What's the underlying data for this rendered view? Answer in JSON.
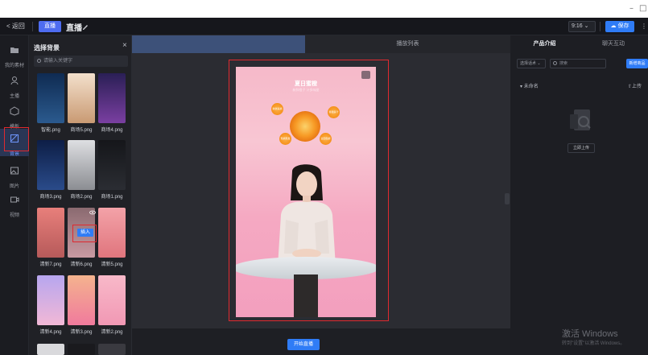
{
  "window": {
    "minimize": "–",
    "maximize": "□"
  },
  "topbar": {
    "back_label": "< 返回",
    "mode_label": "直播",
    "title": "直播",
    "ratio_label": "9:16",
    "save_label": "保存"
  },
  "rail": {
    "items": [
      {
        "label": "我的素材",
        "icon": "folder-icon"
      },
      {
        "label": "主播",
        "icon": "person-icon"
      },
      {
        "label": "模板",
        "icon": "cube-icon"
      },
      {
        "label": "背景",
        "icon": "background-icon",
        "active": true
      },
      {
        "label": "图片",
        "icon": "image-icon"
      },
      {
        "label": "视频",
        "icon": "video-icon"
      }
    ]
  },
  "picker": {
    "title": "选择背景",
    "search_placeholder": "请输入关键字",
    "insert_label": "插入",
    "thumbs": [
      {
        "name": "智能.png",
        "colors": [
          "#0f2b52",
          "#2b5a8e"
        ]
      },
      {
        "name": "商场5.png",
        "colors": [
          "#f3e0cc",
          "#c99a73"
        ]
      },
      {
        "name": "商场4.png",
        "colors": [
          "#2a1f55",
          "#7a3fa1"
        ]
      },
      {
        "name": "商场3.png",
        "colors": [
          "#0d1e46",
          "#2a4b8a"
        ]
      },
      {
        "name": "商场2.png",
        "colors": [
          "#dedfe2",
          "#8b8d92"
        ]
      },
      {
        "name": "商场1.png",
        "colors": [
          "#15161a",
          "#2b2d33"
        ]
      },
      {
        "name": "清新7.png",
        "colors": [
          "#e87f7b",
          "#b65a5a"
        ]
      },
      {
        "name": "清新6.png",
        "colors": [
          "#8a6a70",
          "#c89aa2"
        ]
      },
      {
        "name": "清新5.png",
        "colors": [
          "#f3a2a8",
          "#e0757d"
        ]
      },
      {
        "name": "清新4.png",
        "colors": [
          "#b7a6ef",
          "#f2b8d6"
        ]
      },
      {
        "name": "清新3.png",
        "colors": [
          "#f4b38e",
          "#f07a9d"
        ]
      },
      {
        "name": "清新2.png",
        "colors": [
          "#f8b9c9",
          "#f198b4"
        ]
      }
    ]
  },
  "stage": {
    "tab_right": "播放列表",
    "start_label": "开始直播",
    "canvas": {
      "title": "夏日蜜橙",
      "subtitle": "新鲜橙子 汁多味甜",
      "bubbles": [
        "新鲜采摘",
        "香甜多汁",
        "现摘现发",
        "全国包邮"
      ]
    }
  },
  "rpanel": {
    "tab_a": "产品介绍",
    "tab_b": "聊天互动",
    "select_label": "选择话术",
    "search_placeholder": "搜索",
    "new_label": "新增商品",
    "folder_label": "未命名",
    "upload_link": "上传",
    "upload_btn": "立即上传",
    "watermark_line1": "激活 Windows",
    "watermark_line2": "转到\"设置\"以激活 Windows。"
  }
}
